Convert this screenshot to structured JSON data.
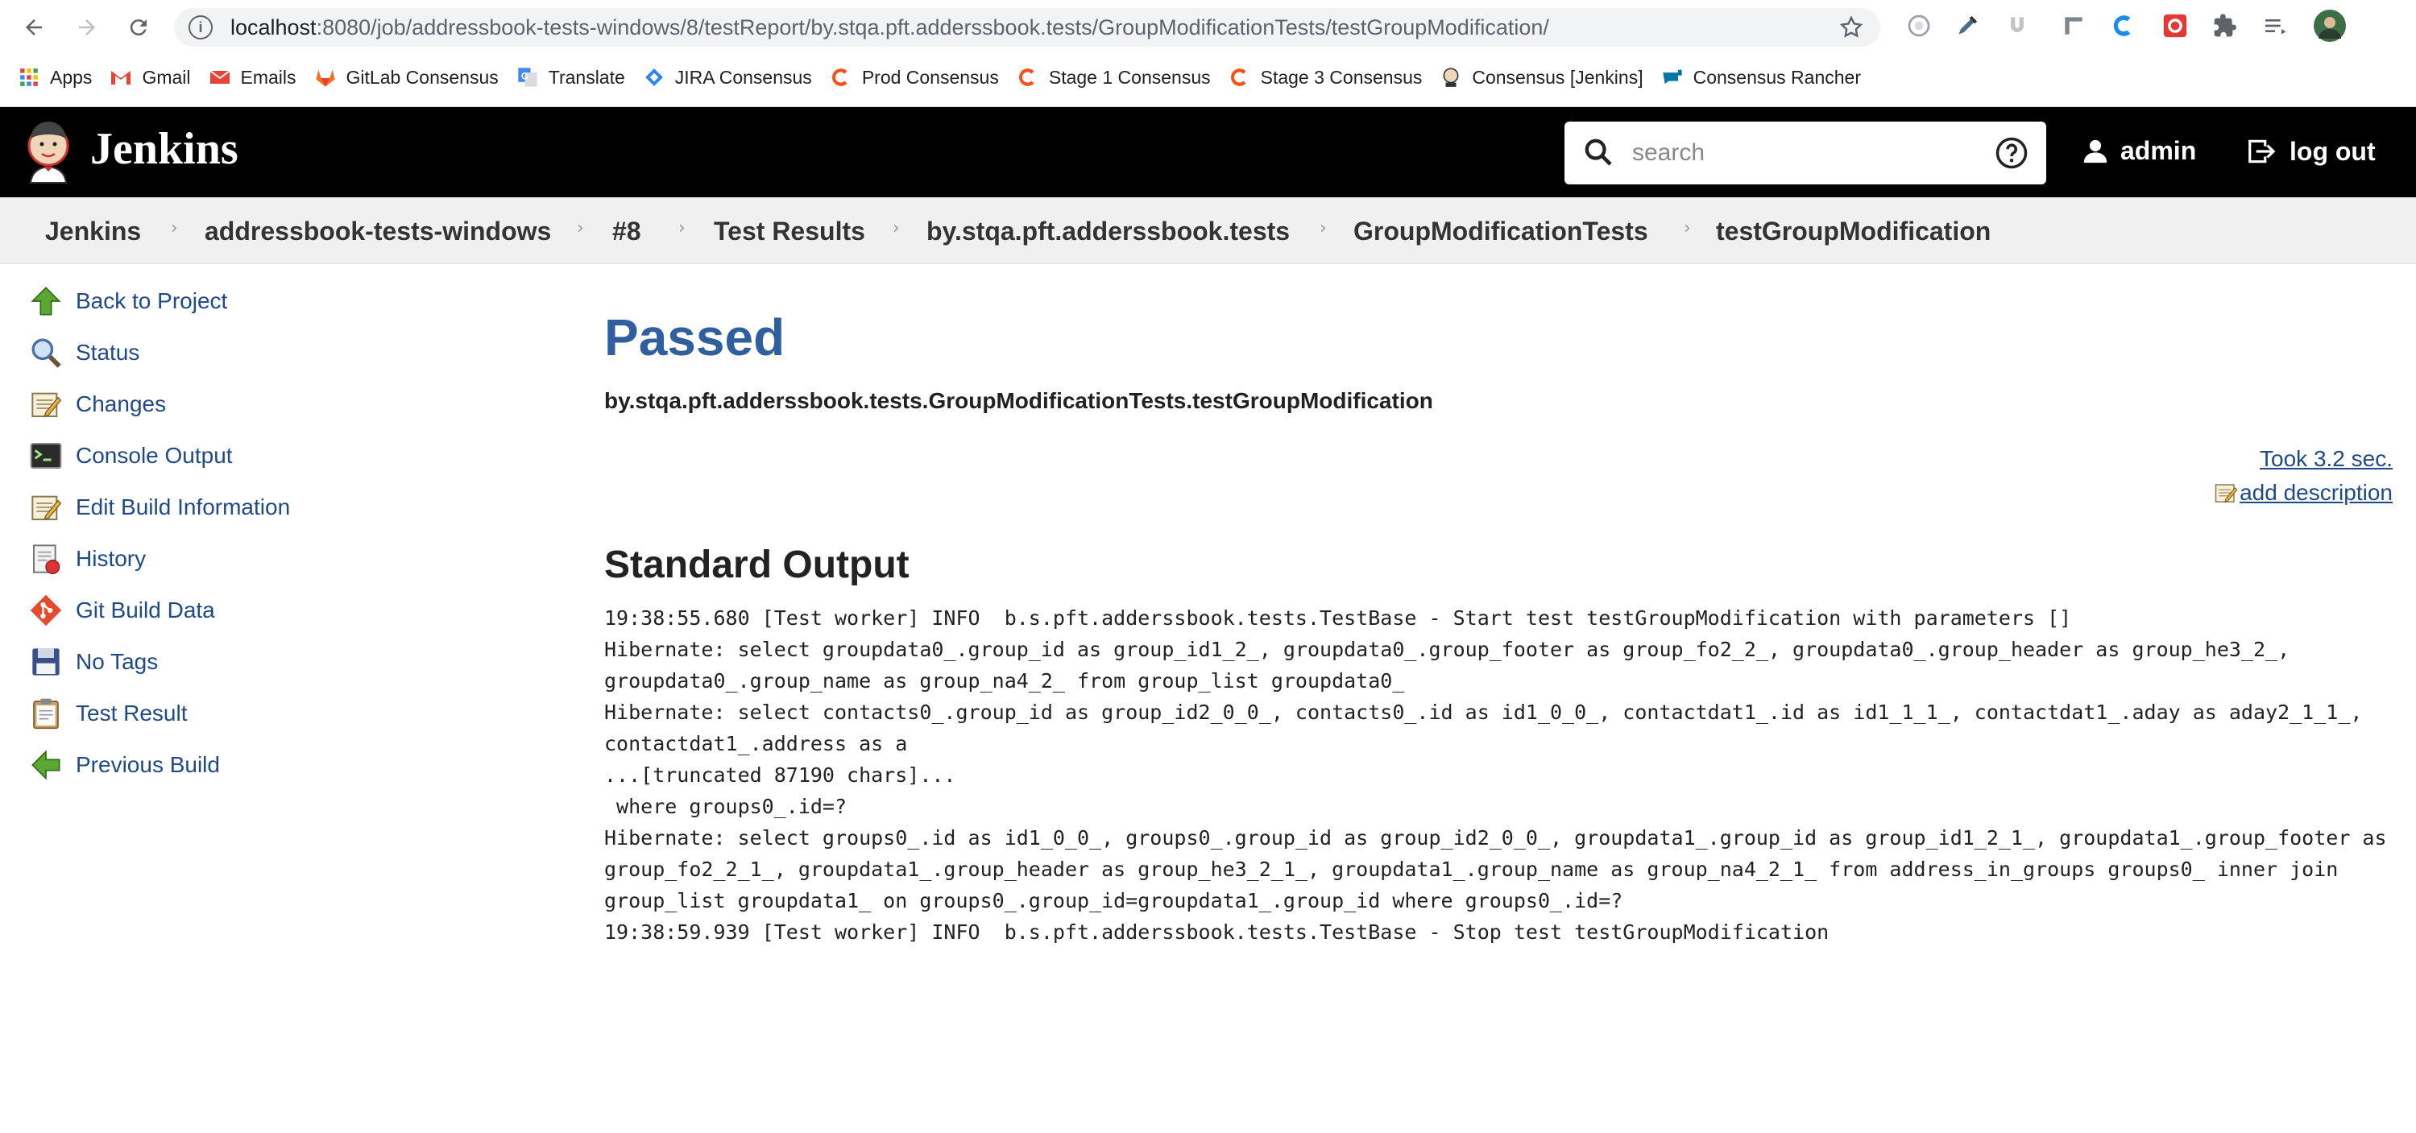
{
  "browser": {
    "url_host": "localhost",
    "url_rest": ":8080/job/addressbook-tests-windows/8/testReport/by.stqa.pft.adderssbook.tests/GroupModificationTests/testGroupModification/",
    "bookmarks": [
      {
        "label": "Apps",
        "icon": "apps-grid-icon"
      },
      {
        "label": "Gmail",
        "icon": "gmail-icon"
      },
      {
        "label": "Emails",
        "icon": "email-icon"
      },
      {
        "label": "GitLab Consensus",
        "icon": "gitlab-icon"
      },
      {
        "label": "Translate",
        "icon": "translate-icon"
      },
      {
        "label": "JIRA Consensus",
        "icon": "jira-icon"
      },
      {
        "label": "Prod Consensus",
        "icon": "consensus-icon"
      },
      {
        "label": "Stage 1 Consensus",
        "icon": "consensus-icon"
      },
      {
        "label": "Stage 3 Consensus",
        "icon": "consensus-icon"
      },
      {
        "label": "Consensus [Jenkins]",
        "icon": "jenkins-icon"
      },
      {
        "label": "Consensus Rancher",
        "icon": "rancher-icon"
      }
    ]
  },
  "header": {
    "title": "Jenkins",
    "search_placeholder": "search",
    "user": "admin",
    "logout": "log out"
  },
  "breadcrumbs": [
    "Jenkins",
    "addressbook-tests-windows",
    "#8",
    "Test Results",
    "by.stqa.pft.adderssbook.tests",
    "GroupModificationTests",
    "testGroupModification"
  ],
  "sidebar": {
    "items": [
      {
        "label": "Back to Project",
        "icon": "up-arrow-icon"
      },
      {
        "label": "Status",
        "icon": "magnifier-icon"
      },
      {
        "label": "Changes",
        "icon": "notepad-icon"
      },
      {
        "label": "Console Output",
        "icon": "terminal-icon"
      },
      {
        "label": "Edit Build Information",
        "icon": "notepad-icon"
      },
      {
        "label": "History",
        "icon": "history-icon"
      },
      {
        "label": "Git Build Data",
        "icon": "git-icon"
      },
      {
        "label": "No Tags",
        "icon": "floppy-icon"
      },
      {
        "label": "Test Result",
        "icon": "clipboard-icon"
      },
      {
        "label": "Previous Build",
        "icon": "left-arrow-icon"
      }
    ]
  },
  "main": {
    "status": "Passed",
    "test_name": "by.stqa.pft.adderssbook.tests.GroupModificationTests.testGroupModification",
    "took": "Took 3.2 sec.",
    "add_description": "add description",
    "section_title": "Standard Output",
    "stdout_lines": [
      "19:38:55.680 [Test worker] INFO  b.s.pft.adderssbook.tests.TestBase - Start test testGroupModification with parameters []",
      "Hibernate: select groupdata0_.group_id as group_id1_2_, groupdata0_.group_footer as group_fo2_2_, groupdata0_.group_header as group_he3_2_,",
      "groupdata0_.group_name as group_na4_2_ from group_list groupdata0_",
      "Hibernate: select contacts0_.group_id as group_id2_0_0_, contacts0_.id as id1_0_0_, contactdat1_.id as id1_1_1_, contactdat1_.aday as aday2_1_1_,",
      "contactdat1_.address as a",
      "...[truncated 87190 chars]...",
      " where groups0_.id=?",
      "Hibernate: select groups0_.id as id1_0_0_, groups0_.group_id as group_id2_0_0_, groupdata1_.group_id as group_id1_2_1_, groupdata1_.group_footer as",
      "group_fo2_2_1_, groupdata1_.group_header as group_he3_2_1_, groupdata1_.group_name as group_na4_2_1_ from address_in_groups groups0_ inner join",
      "group_list groupdata1_ on groups0_.group_id=groupdata1_.group_id where groups0_.id=?",
      "19:38:59.939 [Test worker] INFO  b.s.pft.adderssbook.tests.TestBase - Stop test testGroupModification"
    ]
  },
  "colors": {
    "link": "#204a87",
    "status_passed": "#2f5f9e",
    "header_bg": "#000000",
    "breadcrumb_bg": "#f0f0f0"
  }
}
